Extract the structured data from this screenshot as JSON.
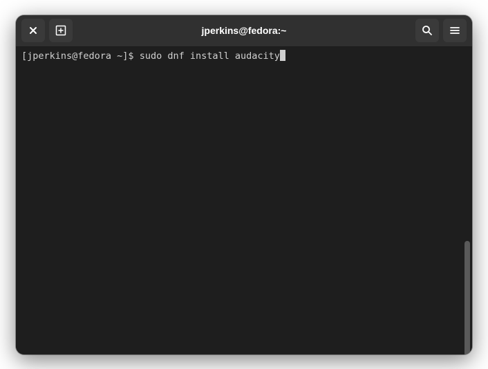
{
  "window": {
    "title": "jperkins@fedora:~"
  },
  "terminal": {
    "prompt": "[jperkins@fedora ~]$ ",
    "command": "sudo dnf install audacity"
  }
}
